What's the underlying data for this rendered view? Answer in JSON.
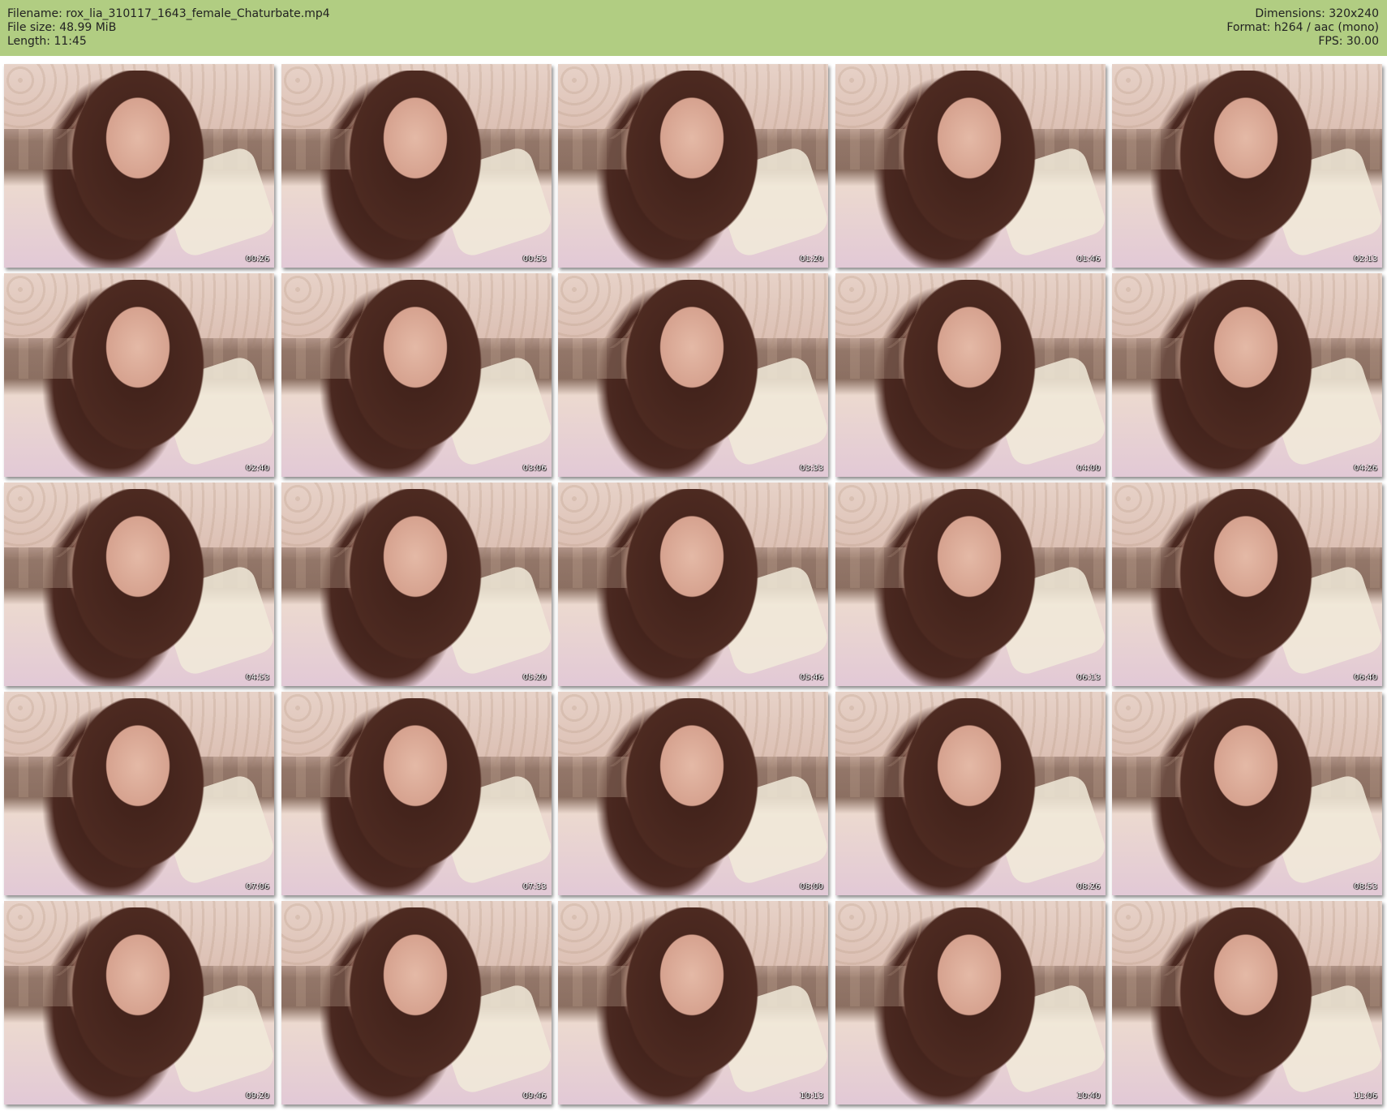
{
  "header": {
    "filename_label": "Filename: rox_lia_310117_1643_female_Chaturbate.mp4",
    "filesize_label": "File size: 48.99 MiB",
    "length_label": "Length: 11:45",
    "dimensions_label": "Dimensions: 320x240",
    "format_label": "Format: h264 / aac (mono)",
    "fps_label": "FPS: 30.00",
    "background_color": "#b1cd82"
  },
  "thumbnails": [
    {
      "timestamp": "00:26"
    },
    {
      "timestamp": "00:53"
    },
    {
      "timestamp": "01:20"
    },
    {
      "timestamp": "01:46"
    },
    {
      "timestamp": "02:13"
    },
    {
      "timestamp": "02:40"
    },
    {
      "timestamp": "03:06"
    },
    {
      "timestamp": "03:33"
    },
    {
      "timestamp": "04:00"
    },
    {
      "timestamp": "04:26"
    },
    {
      "timestamp": "04:53"
    },
    {
      "timestamp": "05:20"
    },
    {
      "timestamp": "05:46"
    },
    {
      "timestamp": "06:13"
    },
    {
      "timestamp": "06:40"
    },
    {
      "timestamp": "07:06"
    },
    {
      "timestamp": "07:33"
    },
    {
      "timestamp": "08:00"
    },
    {
      "timestamp": "08:26"
    },
    {
      "timestamp": "08:53"
    },
    {
      "timestamp": "09:20"
    },
    {
      "timestamp": "09:46"
    },
    {
      "timestamp": "10:13"
    },
    {
      "timestamp": "10:40"
    },
    {
      "timestamp": "11:06"
    }
  ]
}
